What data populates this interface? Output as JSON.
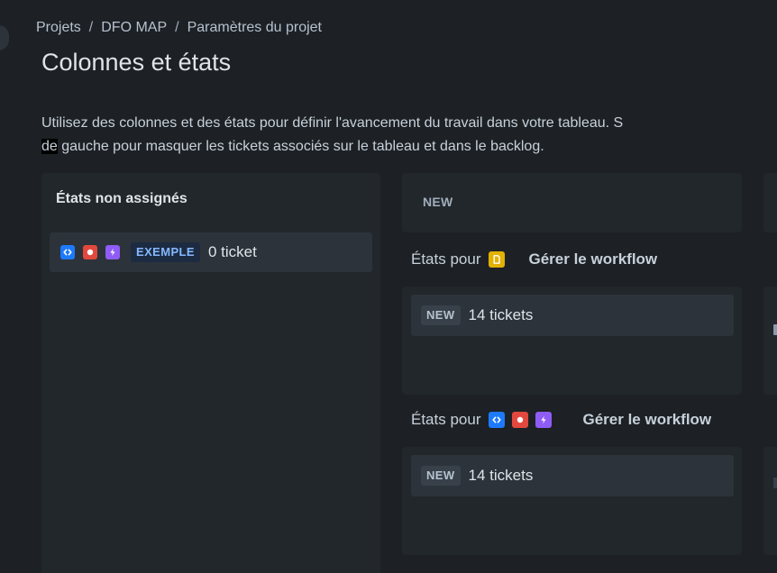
{
  "breadcrumb": {
    "items": [
      "Projets",
      "DFO MAP",
      "Paramètres du projet"
    ],
    "separator": "/"
  },
  "page_title": "Colonnes et états",
  "description": {
    "line1": "Utilisez des colonnes et des états pour définir l'avancement du travail dans votre tableau. S",
    "line2_highlight": "de",
    "line2_rest": " gauche pour masquer les tickets associés sur le tableau et dans le backlog."
  },
  "unassigned": {
    "title": "États non assignés",
    "card": {
      "icons": [
        "task-icon",
        "bug-icon",
        "epic-icon"
      ],
      "status": "EXEMPLE",
      "count": "0 ticket"
    }
  },
  "column": {
    "name": "NEW",
    "groups": [
      {
        "states_for": "États pour",
        "icons": [
          "story-icon"
        ],
        "workflow_link": "Gérer le workflow",
        "status": "NEW",
        "count": "14 tickets"
      },
      {
        "states_for": "États pour",
        "icons": [
          "task-icon",
          "bug-icon",
          "epic-icon"
        ],
        "workflow_link": "Gérer le workflow",
        "status": "NEW",
        "count": "14 tickets"
      }
    ]
  },
  "colors": {
    "background": "#1d2125",
    "panel": "#22272b",
    "card": "#2c333a",
    "task": "#1d7afc",
    "bug": "#e2483d",
    "epic": "#8f5cf7",
    "story": "#e2b203",
    "lozenge_blue_text": "#85b8ff"
  }
}
